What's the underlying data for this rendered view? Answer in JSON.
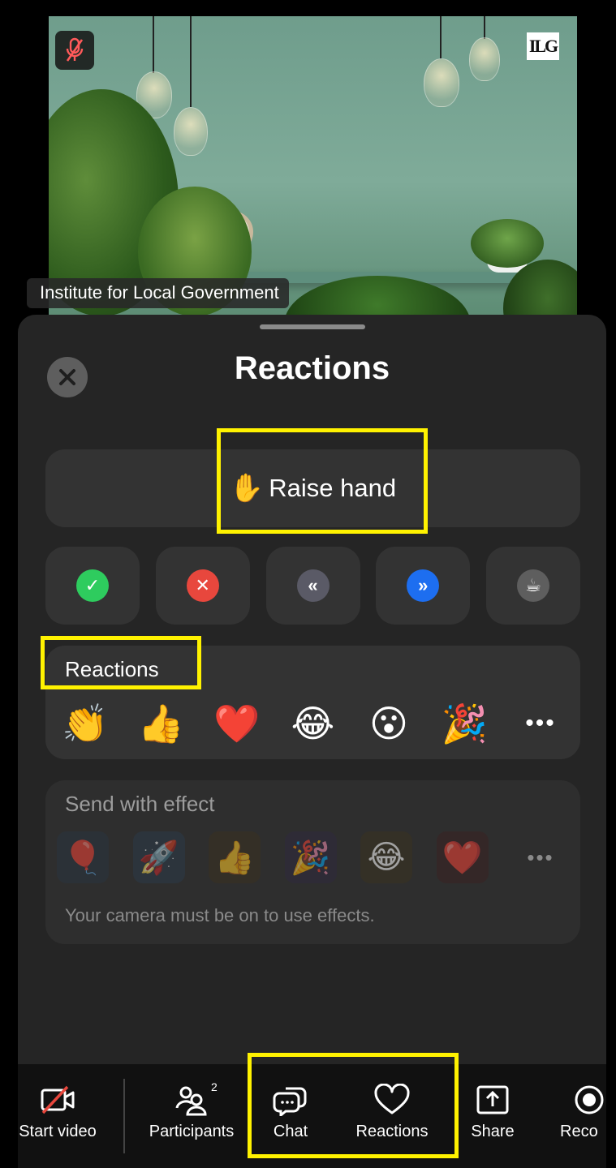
{
  "video": {
    "participant_name": "Institute for Local Government",
    "logo_text": "ILG",
    "mic_status": "muted"
  },
  "sheet": {
    "title": "Reactions",
    "raise_hand": {
      "emoji": "✋",
      "label": "Raise hand"
    },
    "quick_actions": [
      {
        "name": "yes",
        "glyph": "✓",
        "color": "#2ecc5e"
      },
      {
        "name": "no",
        "glyph": "✕",
        "color": "#e8473d"
      },
      {
        "name": "go-slower",
        "glyph": "«",
        "color": "#5a5a66"
      },
      {
        "name": "go-faster",
        "glyph": "»",
        "color": "#1d6ef0"
      },
      {
        "name": "coffee",
        "glyph": "☕",
        "color": "#5e5e5e"
      }
    ],
    "reactions": {
      "label": "Reactions",
      "emojis": [
        "👏",
        "👍",
        "❤️",
        "😂",
        "😮",
        "🎉"
      ],
      "more": "•••"
    },
    "effects": {
      "label": "Send with effect",
      "emojis": [
        "🎈",
        "🚀",
        "👍",
        "🎉",
        "😂",
        "❤️"
      ],
      "more": "•••",
      "note": "Your camera must be on to use effects."
    }
  },
  "toolbar": {
    "start_video": "Start video",
    "participants": "Participants",
    "participants_count": "2",
    "chat": "Chat",
    "reactions": "Reactions",
    "share": "Share",
    "record": "Reco"
  },
  "colors": {
    "highlight": "#fff200",
    "sheet_bg": "#252525",
    "card_bg": "#333333",
    "toolbar_bg": "#111111"
  }
}
